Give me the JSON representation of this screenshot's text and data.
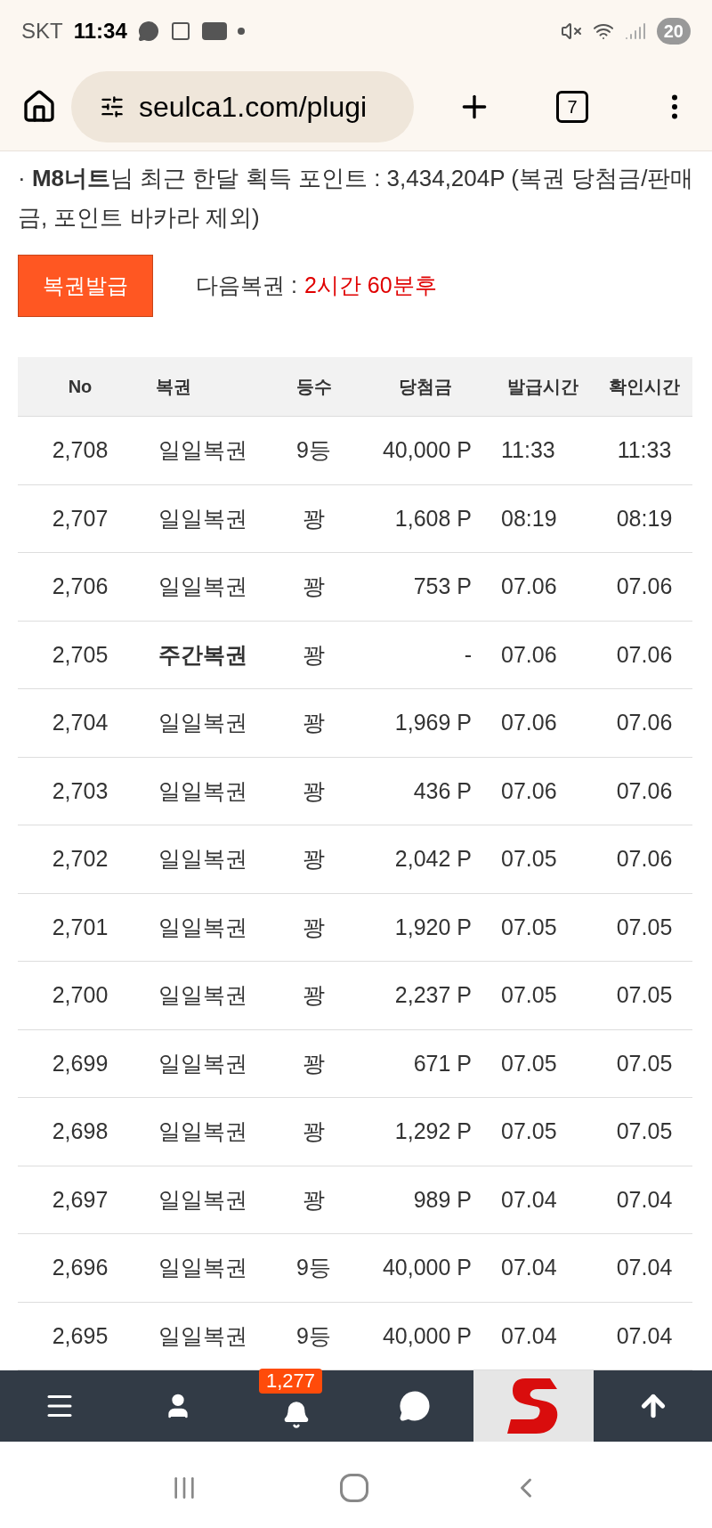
{
  "status_bar": {
    "carrier": "SKT",
    "time": "11:34",
    "battery": "20"
  },
  "browser": {
    "url": "seulca1.com/plugi",
    "tab_count": "7"
  },
  "notice": {
    "text": "· **M8너트**님 최근 한달 획득 포인트 : 3,434,204P (복권 당첨금/판매금, 포인트 바카라 제외)"
  },
  "issue_button": "복권발급",
  "next_lottery": {
    "label": "다음복권 :",
    "value": "2시간 60분후"
  },
  "table": {
    "columns": [
      "No",
      "복권",
      "등수",
      "당첨금",
      "발급시간",
      "확인시간"
    ],
    "rows": [
      {
        "cells": [
          "2,708",
          "일일복권",
          "9등",
          "40,000 P",
          "11:33",
          "11:33"
        ],
        "emphasized": false
      },
      {
        "cells": [
          "2,707",
          "일일복권",
          "꽝",
          "1,608 P",
          "08:19",
          "08:19"
        ],
        "emphasized": false
      },
      {
        "cells": [
          "2,706",
          "일일복권",
          "꽝",
          "753 P",
          "07.06",
          "07.06"
        ],
        "emphasized": false
      },
      {
        "cells": [
          "2,705",
          "주간복권",
          "꽝",
          "-",
          "07.06",
          "07.06"
        ],
        "emphasized": true
      },
      {
        "cells": [
          "2,704",
          "일일복권",
          "꽝",
          "1,969 P",
          "07.06",
          "07.06"
        ],
        "emphasized": false
      },
      {
        "cells": [
          "2,703",
          "일일복권",
          "꽝",
          "436 P",
          "07.06",
          "07.06"
        ],
        "emphasized": false
      },
      {
        "cells": [
          "2,702",
          "일일복권",
          "꽝",
          "2,042 P",
          "07.05",
          "07.06"
        ],
        "emphasized": false
      },
      {
        "cells": [
          "2,701",
          "일일복권",
          "꽝",
          "1,920 P",
          "07.05",
          "07.05"
        ],
        "emphasized": false
      },
      {
        "cells": [
          "2,700",
          "일일복권",
          "꽝",
          "2,237 P",
          "07.05",
          "07.05"
        ],
        "emphasized": false
      },
      {
        "cells": [
          "2,699",
          "일일복권",
          "꽝",
          "671 P",
          "07.05",
          "07.05"
        ],
        "emphasized": false
      },
      {
        "cells": [
          "2,698",
          "일일복권",
          "꽝",
          "1,292 P",
          "07.05",
          "07.05"
        ],
        "emphasized": false
      },
      {
        "cells": [
          "2,697",
          "일일복권",
          "꽝",
          "989 P",
          "07.04",
          "07.04"
        ],
        "emphasized": false
      },
      {
        "cells": [
          "2,696",
          "일일복권",
          "9등",
          "40,000 P",
          "07.04",
          "07.04"
        ],
        "emphasized": false
      },
      {
        "cells": [
          "2,695",
          "일일복권",
          "9등",
          "40,000 P",
          "07.04",
          "07.04"
        ],
        "emphasized": false
      }
    ]
  },
  "bottom_nav": {
    "notification_badge": "1,277"
  }
}
